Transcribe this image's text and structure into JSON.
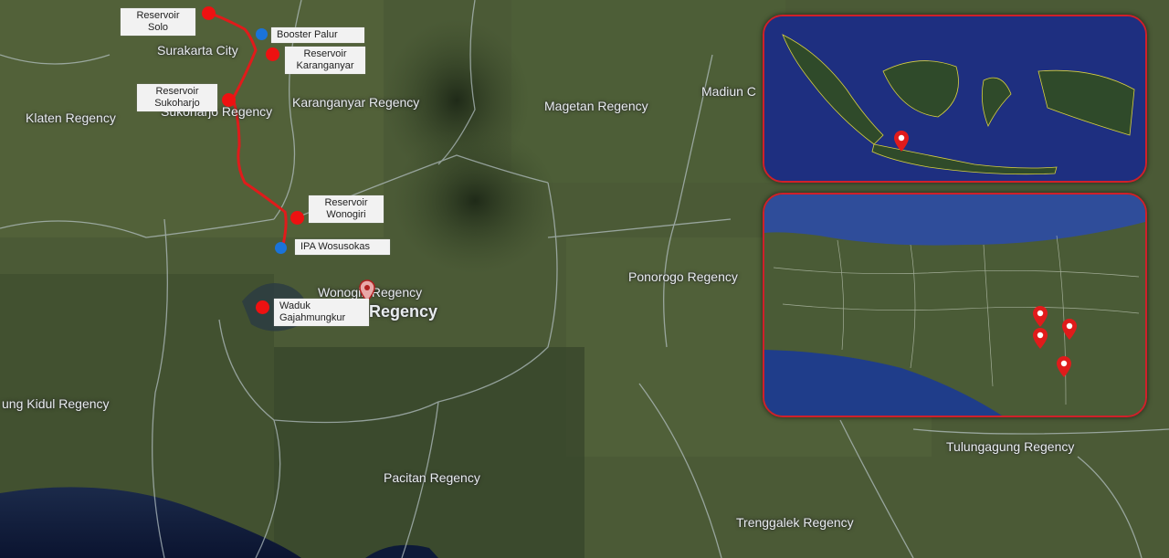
{
  "map": {
    "regions": {
      "surakarta": "Surakarta City",
      "karanganyar": "Karanganyar Regency",
      "klaten": "Klaten Regency",
      "sukoharjo": "Sukoharjo Regency",
      "magetan": "Magetan Regency",
      "madiun": "Madiun C",
      "wonogiri_small": "Wonogiri Regency",
      "wonogiri_big": "Regency",
      "ponorogo": "Ponorogo Regency",
      "gunungkidul": "ung Kidul Regency",
      "pacitan": "Pacitan Regency",
      "tulungagung": "Tulungagung Regency",
      "trenggalek": "Trenggalek Regency"
    },
    "labels": {
      "reservoir_solo": [
        "Reservoir",
        "Solo"
      ],
      "booster_palur": "Booster  Palur",
      "reservoir_karanganyar": [
        "Reservoir",
        "Karanganyar"
      ],
      "reservoir_sukoharjo": [
        "Reservoir",
        "Sukoharjo"
      ],
      "reservoir_wonogiri": [
        "Reservoir",
        "Wonogiri"
      ],
      "ipa_wosusokas": "IPA Wosusokas",
      "waduk": [
        "Waduk",
        "Gajahmungkur"
      ]
    },
    "colors": {
      "reservoir_marker": "#ee1111",
      "booster_marker": "#1a73d9",
      "pipeline": "#e01b1b",
      "inset_border": "#d0202a"
    }
  }
}
